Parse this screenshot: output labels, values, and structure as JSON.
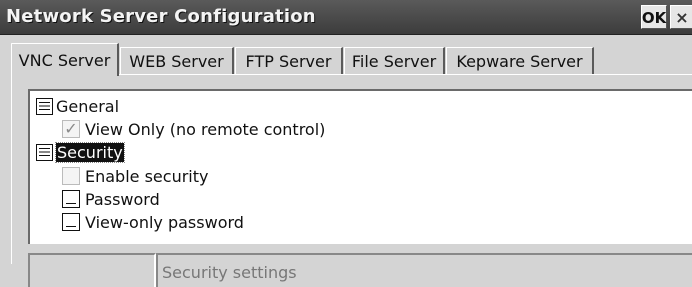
{
  "window": {
    "title": "Network Server Configuration",
    "ok_label": "OK",
    "close_label": "×"
  },
  "tabs": [
    {
      "label": "VNC Server",
      "active": true
    },
    {
      "label": "WEB Server",
      "active": false
    },
    {
      "label": "FTP Server",
      "active": false
    },
    {
      "label": "File Server",
      "active": false
    },
    {
      "label": "Kepware Server",
      "active": false
    }
  ],
  "tree": {
    "general": {
      "label": "General",
      "icon": "list-icon",
      "items": [
        {
          "label": "View Only (no remote control)",
          "type": "checkbox",
          "checked": true,
          "mark": "✓"
        }
      ]
    },
    "security": {
      "label": "Security",
      "icon": "list-icon",
      "selected": true,
      "items": [
        {
          "label": "Enable security",
          "type": "checkbox",
          "checked": false
        },
        {
          "label": "Password",
          "type": "text-field"
        },
        {
          "label": "View-only password",
          "type": "text-field"
        }
      ]
    }
  },
  "status": {
    "left": "",
    "right": "Security settings"
  },
  "colors": {
    "titlebar": "#4a4a4a",
    "window_bg": "#d4d4d4",
    "tree_bg": "#ffffff",
    "selection": "#111111"
  }
}
